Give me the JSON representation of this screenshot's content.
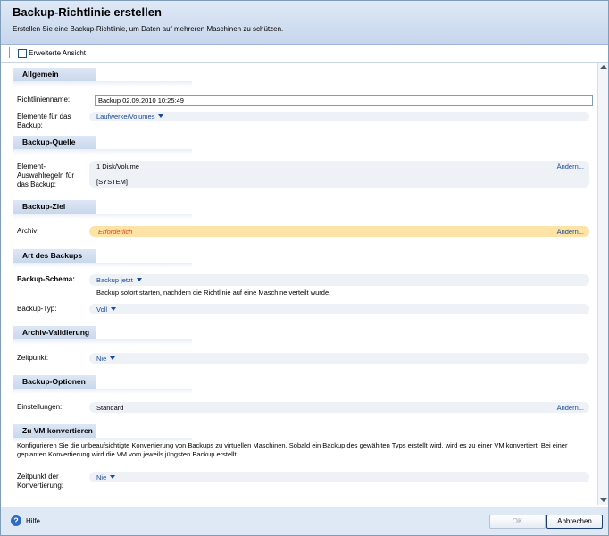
{
  "header": {
    "title": "Backup-Richtlinie erstellen",
    "subtitle": "Erstellen Sie eine Backup-Richtlinie, um Daten auf mehreren Maschinen zu schützen."
  },
  "toolbar": {
    "advanced_view_label": "Erweiterte Ansicht",
    "advanced_view_checked": false
  },
  "sections": {
    "general": {
      "title": "Allgemein",
      "policy_name_label": "Richtlinienname:",
      "policy_name_value": "Backup 02.09.2010 10:25:49",
      "items_label": "Elemente für das Backup:",
      "items_value": "Laufwerke/Volumes"
    },
    "source": {
      "title": "Backup-Quelle",
      "rules_label": "Element-Auswahlregeln für das Backup:",
      "rules_line1": "1 Disk/Volume",
      "rules_line2": "[SYSTEM]",
      "change_label": "Ändern..."
    },
    "target": {
      "title": "Backup-Ziel",
      "archive_label": "Archiv:",
      "archive_value": "Erforderlich",
      "change_label": "Ändern..."
    },
    "type": {
      "title": "Art des Backups",
      "scheme_label": "Backup-Schema:",
      "scheme_value": "Backup jetzt",
      "scheme_desc": "Backup sofort starten, nachdem die Richtlinie auf eine Maschine verteilt wurde.",
      "backup_type_label": "Backup-Typ:",
      "backup_type_value": "Voll"
    },
    "validation": {
      "title": "Archiv-Validierung",
      "time_label": "Zeitpunkt:",
      "time_value": "Nie"
    },
    "options": {
      "title": "Backup-Optionen",
      "settings_label": "Einstellungen:",
      "settings_value": "Standard",
      "change_label": "Ändern..."
    },
    "vm": {
      "title": "Zu VM konvertieren",
      "description": "Konfigurieren Sie die unbeaufsichtigte Konvertierung von Backups zu virtuellen Maschinen. Sobald ein Backup des gewählten Typs erstellt wird, wird es zu einer VM konvertiert. Bei einer geplanten Konvertierung wird die VM vom jeweils jüngsten Backup erstellt.",
      "time_label": "Zeitpunkt der Konvertierung:",
      "time_value": "Nie"
    }
  },
  "footer": {
    "help_label": "Hilfe",
    "ok_label": "OK",
    "cancel_label": "Abbrechen"
  },
  "colors": {
    "header_bg": "#c6d6ec",
    "required_bg": "#fde3a5",
    "required_text": "#d84a1b",
    "link": "#1a4a95"
  }
}
